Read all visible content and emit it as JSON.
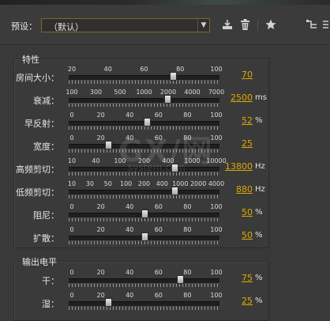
{
  "toolbar": {
    "preset_label": "预设：",
    "preset_value": "（默认）",
    "dropdown_arrow": "▼",
    "icons": [
      "save-preset-icon",
      "delete-preset-icon",
      "favorite-star-icon",
      "routing-icon"
    ]
  },
  "group_character": {
    "title": "特性",
    "rows": [
      {
        "label": "房间大小：",
        "ticks": [
          "20",
          "40",
          "60",
          "80",
          "100"
        ],
        "value": "70",
        "unit": "",
        "fraction": 0.7
      },
      {
        "label": "衰减：",
        "ticks": [
          "100",
          "300",
          "500",
          "1000",
          "2000",
          "4000",
          "7000"
        ],
        "value": "2500",
        "unit": "ms",
        "fraction": 0.66
      },
      {
        "label": "早反射：",
        "ticks": [
          "0",
          "20",
          "40",
          "60",
          "80",
          "100"
        ],
        "value": "52",
        "unit": "%",
        "fraction": 0.52
      },
      {
        "label": "宽度：",
        "ticks": [
          "0",
          "20",
          "40",
          "60",
          "80",
          "100"
        ],
        "value": "25",
        "unit": "",
        "fraction": 0.25
      },
      {
        "label": "高频剪切：",
        "ticks": [
          "10",
          "40",
          "100",
          "200",
          "400",
          "1000",
          "10000"
        ],
        "value": "13800",
        "unit": "Hz",
        "fraction": 0.71
      },
      {
        "label": "低频剪切：",
        "ticks": [
          "10",
          "30",
          "50",
          "100",
          "200",
          "400",
          "1000",
          "2000",
          "4000"
        ],
        "value": "880",
        "unit": "Hz",
        "fraction": 0.71
      },
      {
        "label": "阻尼：",
        "ticks": [
          "0",
          "20",
          "40",
          "60",
          "80",
          "100"
        ],
        "value": "50",
        "unit": "%",
        "fraction": 0.5
      },
      {
        "label": "扩散：",
        "ticks": [
          "0",
          "20",
          "40",
          "60",
          "80",
          "100"
        ],
        "value": "50",
        "unit": "%",
        "fraction": 0.5
      }
    ]
  },
  "group_output": {
    "title": "输出电平",
    "rows": [
      {
        "label": "干：",
        "ticks": [
          "0",
          "20",
          "40",
          "60",
          "80",
          "100"
        ],
        "value": "75",
        "unit": "%",
        "fraction": 0.75
      },
      {
        "label": "湿：",
        "ticks": [
          "0",
          "20",
          "40",
          "60",
          "80",
          "100"
        ],
        "value": "25",
        "unit": "%",
        "fraction": 0.25
      }
    ]
  },
  "watermark": {
    "big": "GX/网",
    "small": "system.com"
  },
  "colors": {
    "value_accent": "#e0a800",
    "panel_bg": "#393939"
  }
}
